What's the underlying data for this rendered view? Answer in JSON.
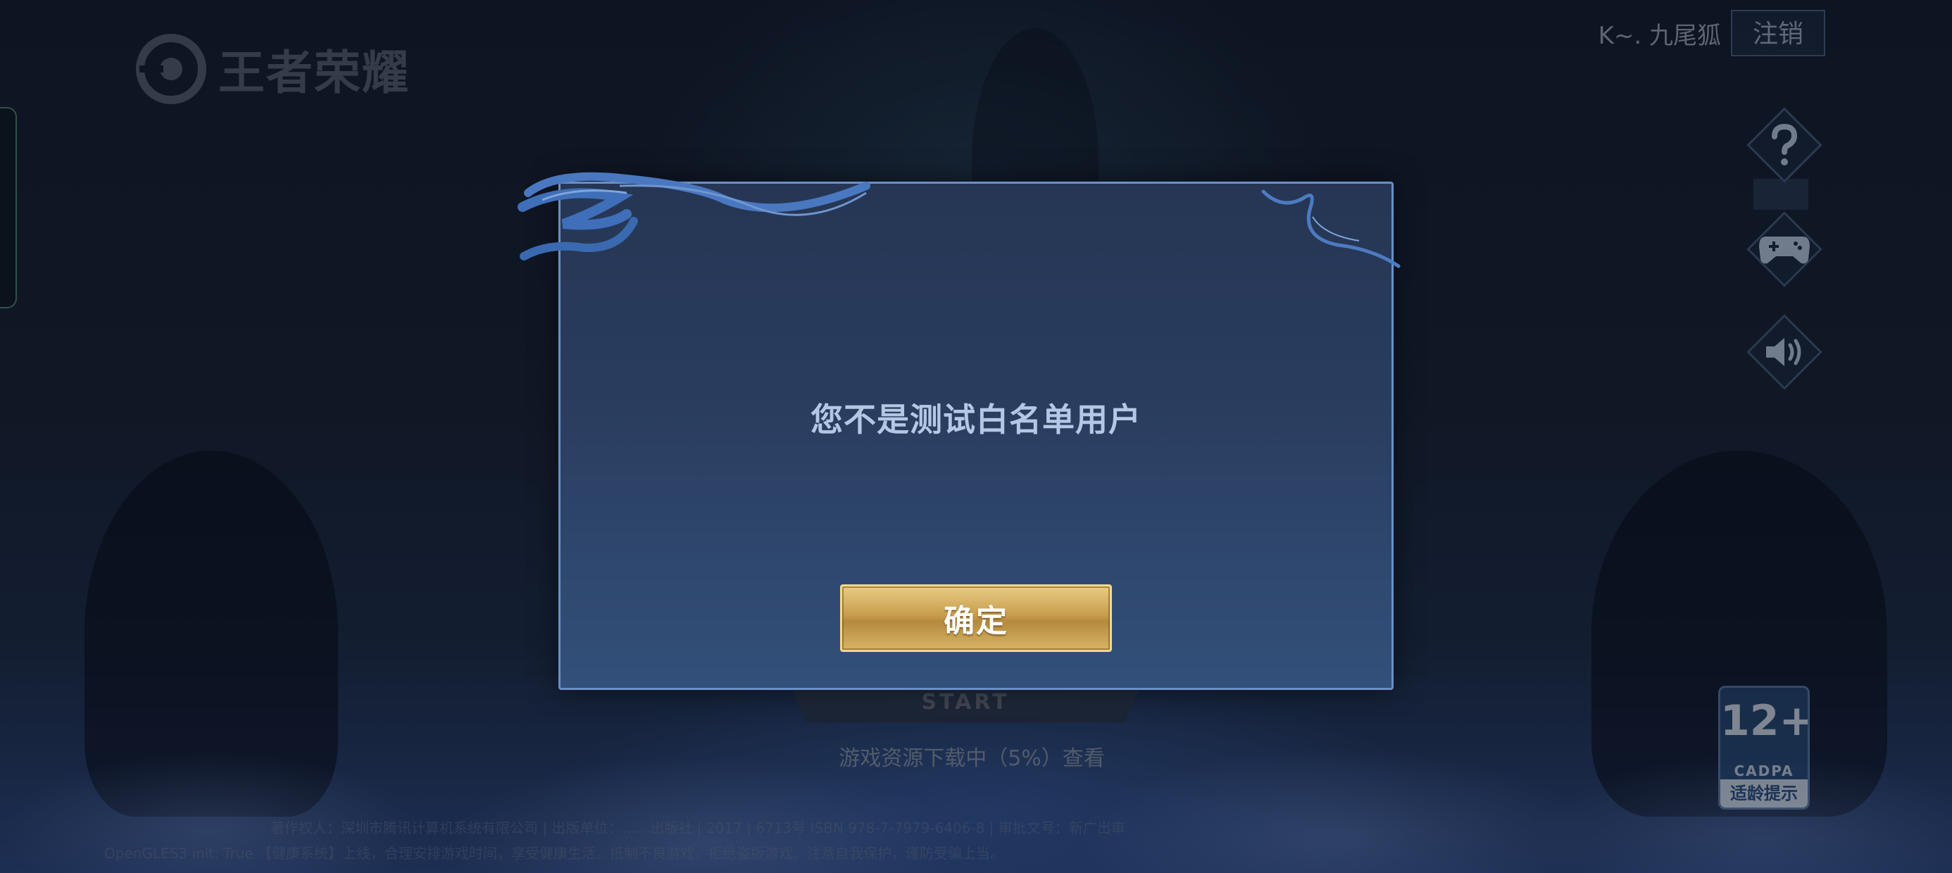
{
  "logo": {
    "text": "王者荣耀",
    "icon": "game-logo-icon"
  },
  "account": {
    "name": "K~. 九尾狐",
    "logout_label": "注销"
  },
  "side_icons": [
    "help-icon",
    "gamepad-icon",
    "volume-icon"
  ],
  "start": {
    "label": "START"
  },
  "download": {
    "status": "游戏资源下载中（5%）查看"
  },
  "footer": {
    "line1": "著作权人：深圳市腾讯计算机系统有限公司 | 出版单位：……出版社 | 2017 | 6713号 ISBN 978-7-7979-6406-8 | 审批文号：新广出审",
    "line2": "OpenGLES3 init: True 【健康系统】上线，合理安排游戏时间，享受健康生活。抵制不良游戏，拒绝盗版游戏。注意自我保护，谨防受骗上当。"
  },
  "age_rating": {
    "number": "12+",
    "org": "CADPA",
    "tip": "适龄提示"
  },
  "modal": {
    "message": "您不是测试白名单用户",
    "confirm_label": "确定"
  },
  "colors": {
    "modal_border": "#6b8fc4",
    "modal_bg": "#2a3d5f",
    "button_gold": "#c89e4d",
    "message_text": "#b4c7e4"
  }
}
